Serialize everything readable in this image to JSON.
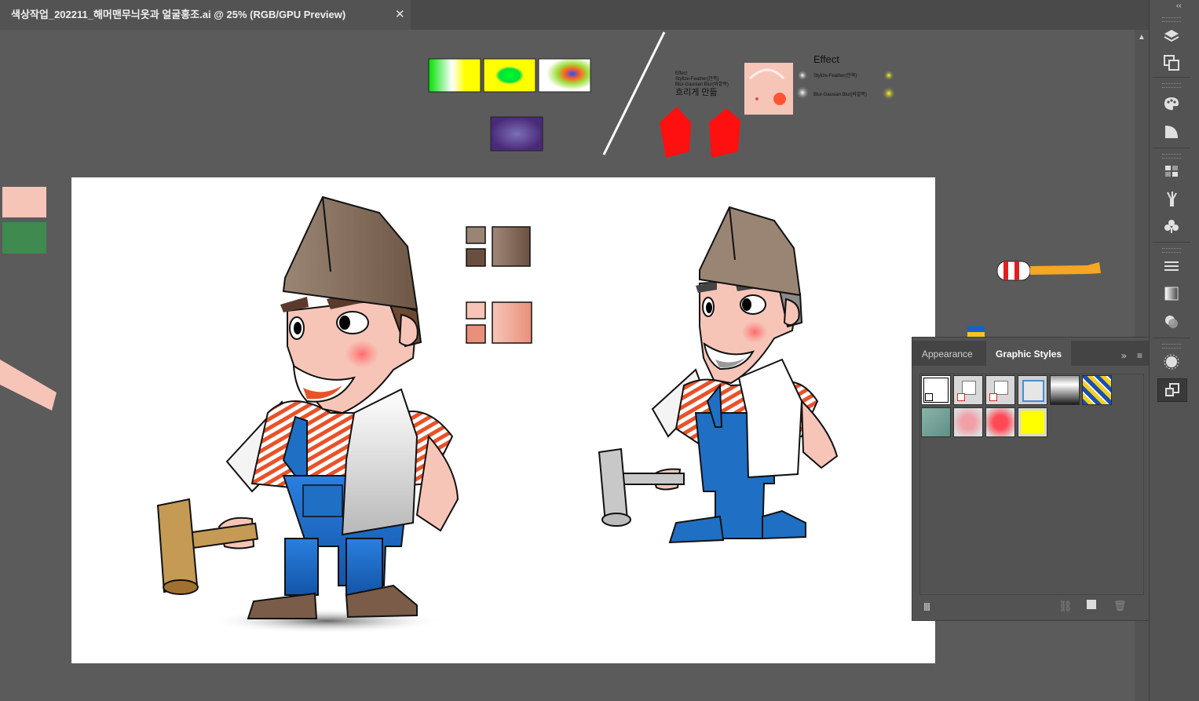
{
  "document_tab": {
    "title": "색상작업_202211_해머맨무늬옷과 얼굴홍조.ai @ 25% (RGB/GPU Preview)",
    "close_glyph": "✕"
  },
  "canvas_text": {
    "effect_heading": "Effect",
    "effect_small_1": "Effect",
    "effect_small_2": "Stylize-Feather(안쪽)",
    "effect_small_3": "Blur-Gausian Blur(바깥쪽)",
    "blur_make": "흐리게 만듦",
    "legend_feather": "Stylize-Feather(안쪽)",
    "legend_gausian": "Blur-Gausian Blur(바깥쪽)"
  },
  "panel": {
    "tab_appearance": "Appearance",
    "tab_graphic_styles": "Graphic Styles",
    "expand_glyph": "»",
    "menu_glyph": "≡",
    "styles": [
      {
        "name": "default",
        "icon": "default-style-swatch"
      },
      {
        "name": "none-1",
        "icon": "no-fill-swatch"
      },
      {
        "name": "none-2",
        "icon": "no-fill-swatch"
      },
      {
        "name": "blue-outline",
        "icon": "blue-outline-swatch"
      },
      {
        "name": "gray-gradient",
        "icon": "gradient-swatch"
      },
      {
        "name": "blue-yellow-pattern",
        "icon": "pattern-swatch"
      },
      {
        "name": "green-leaf",
        "icon": "leaf-swatch"
      },
      {
        "name": "pink-blur",
        "icon": "pink-blur-swatch"
      },
      {
        "name": "red-blur",
        "icon": "red-blur-swatch"
      },
      {
        "name": "yellow",
        "icon": "yellow-swatch"
      }
    ]
  },
  "toolstrip": {
    "collapse_glyph": "‹‹",
    "tools": [
      "layers-icon",
      "artboards-icon",
      "color-icon",
      "color-guide-icon",
      "swatches-icon",
      "brushes-icon",
      "symbols-icon",
      "stroke-icon",
      "gradient-icon",
      "transparency-icon",
      "appearance-icon",
      "graphic-styles-icon"
    ]
  },
  "colors": {
    "skin": "#f7c5b8",
    "hat": "#8c7462",
    "overalls": "#1f6fc4",
    "shoes": "#7a5c48",
    "hammer_wood": "#c49a55"
  }
}
